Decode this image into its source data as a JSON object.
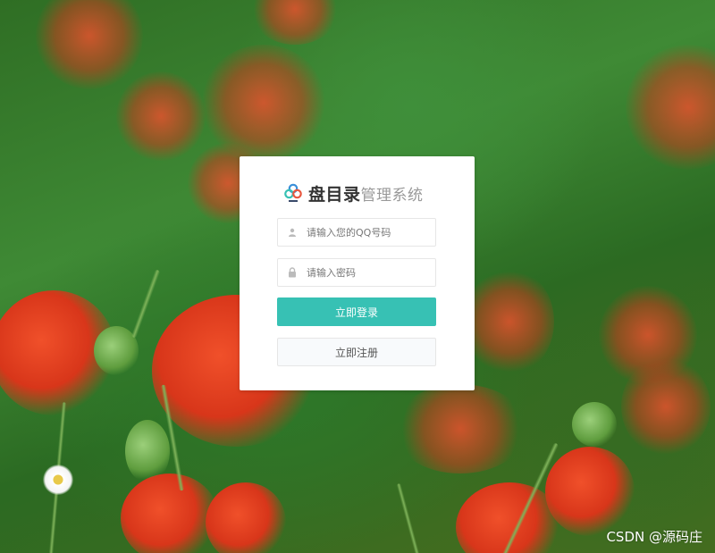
{
  "brand": {
    "name": "盘目录",
    "subtitle": "管理系统",
    "logo_icon": "cloud-rings-logo-icon",
    "accent": "#37c1b4"
  },
  "login": {
    "username_placeholder": "请输入您的QQ号码",
    "username_value": "",
    "username_icon": "user-icon",
    "password_placeholder": "请输入密码",
    "password_value": "",
    "password_icon": "lock-icon",
    "login_label": "立即登录",
    "register_label": "立即注册"
  },
  "watermark": {
    "text": "CSDN @源码庄"
  }
}
